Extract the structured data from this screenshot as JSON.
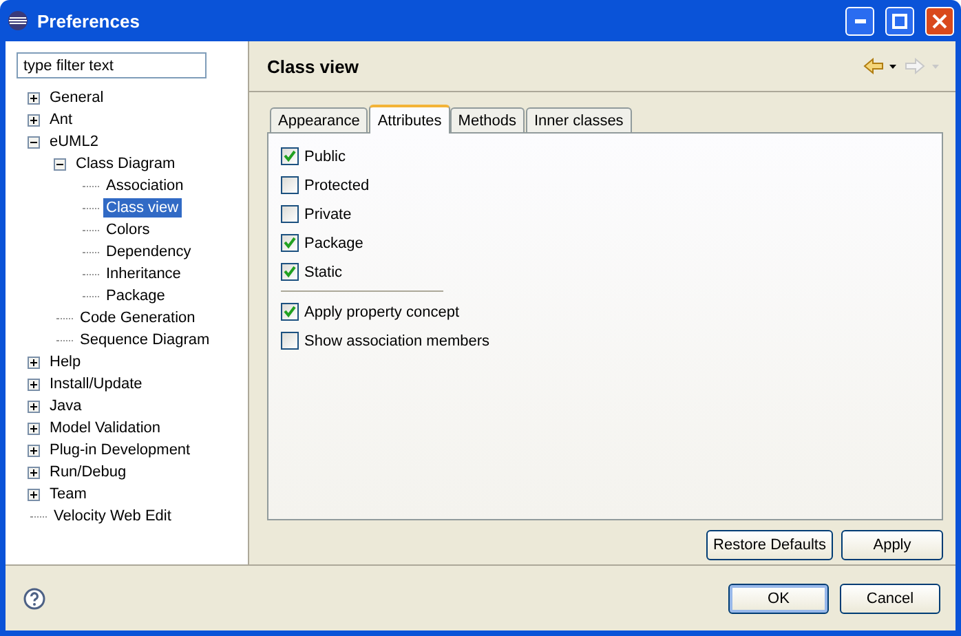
{
  "window": {
    "title": "Preferences"
  },
  "filter": {
    "placeholder": "type filter text"
  },
  "tree": [
    {
      "label": "General",
      "expanded": false,
      "selected": false
    },
    {
      "label": "Ant",
      "expanded": false,
      "selected": false
    },
    {
      "label": "eUML2",
      "expanded": true,
      "selected": false,
      "children": [
        {
          "label": "Class Diagram",
          "expanded": true,
          "selected": false,
          "children": [
            {
              "label": "Association",
              "selected": false
            },
            {
              "label": "Class view",
              "selected": true
            },
            {
              "label": "Colors",
              "selected": false
            },
            {
              "label": "Dependency",
              "selected": false
            },
            {
              "label": "Inheritance",
              "selected": false
            },
            {
              "label": "Package",
              "selected": false
            }
          ]
        },
        {
          "label": "Code Generation",
          "selected": false
        },
        {
          "label": "Sequence Diagram",
          "selected": false
        }
      ]
    },
    {
      "label": "Help",
      "expanded": false,
      "selected": false
    },
    {
      "label": "Install/Update",
      "expanded": false,
      "selected": false
    },
    {
      "label": "Java",
      "expanded": false,
      "selected": false
    },
    {
      "label": "Model Validation",
      "expanded": false,
      "selected": false
    },
    {
      "label": "Plug-in Development",
      "expanded": false,
      "selected": false
    },
    {
      "label": "Run/Debug",
      "expanded": false,
      "selected": false
    },
    {
      "label": "Team",
      "expanded": false,
      "selected": false
    },
    {
      "label": "Velocity Web Edit",
      "selected": false
    }
  ],
  "page": {
    "title": "Class view",
    "back_enabled": true,
    "forward_enabled": false
  },
  "tabs": [
    {
      "label": "Appearance",
      "selected": false
    },
    {
      "label": "Attributes",
      "selected": true
    },
    {
      "label": "Methods",
      "selected": false
    },
    {
      "label": "Inner classes",
      "selected": false
    }
  ],
  "options": [
    {
      "kind": "checkbox",
      "label": "Public",
      "checked": true
    },
    {
      "kind": "checkbox",
      "label": "Protected",
      "checked": false
    },
    {
      "kind": "checkbox",
      "label": "Private",
      "checked": false
    },
    {
      "kind": "checkbox",
      "label": "Package",
      "checked": true
    },
    {
      "kind": "checkbox",
      "label": "Static",
      "checked": true
    },
    {
      "kind": "separator"
    },
    {
      "kind": "checkbox",
      "label": "Apply property concept",
      "checked": true
    },
    {
      "kind": "checkbox",
      "label": "Show association members",
      "checked": false
    }
  ],
  "page_buttons": [
    "Restore Defaults",
    "Apply"
  ],
  "dialog_buttons": [
    {
      "label": "OK",
      "default": true
    },
    {
      "label": "Cancel",
      "default": false
    }
  ]
}
